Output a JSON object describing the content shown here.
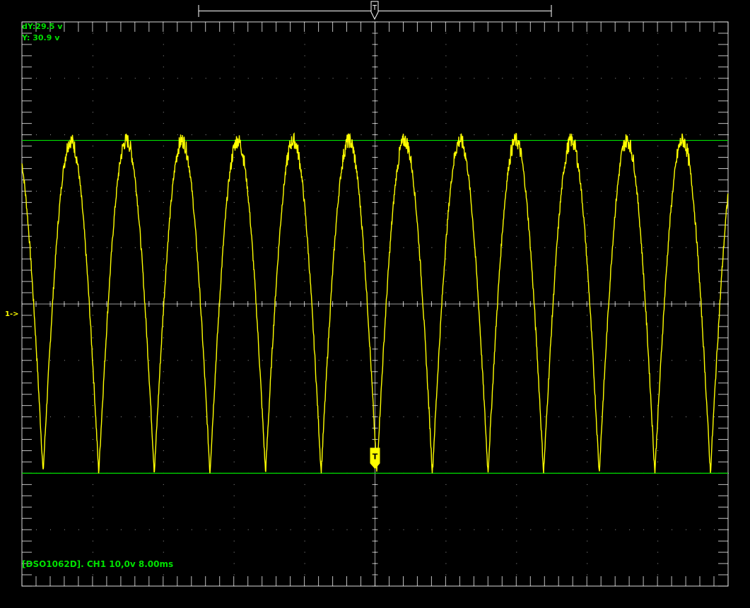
{
  "readouts": {
    "dy_label": "dY:",
    "dy_value": "29.5 v",
    "y_label": "Y: ",
    "y_value": "30.9 v"
  },
  "channel_marker": "1->",
  "trigger_label": "T",
  "status_text": "[DSO1062D]. CH1 10,0v 8.00ms",
  "colors": {
    "background": "#000000",
    "grid": "#ffffff",
    "trace": "#ffff00",
    "cursor": "#00e000",
    "text": "#00e000"
  },
  "chart_data": {
    "type": "line",
    "title": "",
    "xlabel": "",
    "ylabel": "",
    "volts_per_div": 10.0,
    "time_per_div_ms": 8.0,
    "x_divisions": 10,
    "y_divisions": 10,
    "y_range": [
      -10,
      40
    ],
    "x_range_ms": [
      -40,
      40
    ],
    "grid": true,
    "trace_name": "CH1",
    "waveform": "full-wave rectified sine",
    "period_ms": 6.3,
    "peak_v": 29.5,
    "trough_v": 0.0,
    "first_trough_ms": -37.6,
    "cursors": [
      {
        "name": "upper",
        "y": 29.5
      },
      {
        "name": "lower",
        "y": 0.0
      }
    ]
  }
}
